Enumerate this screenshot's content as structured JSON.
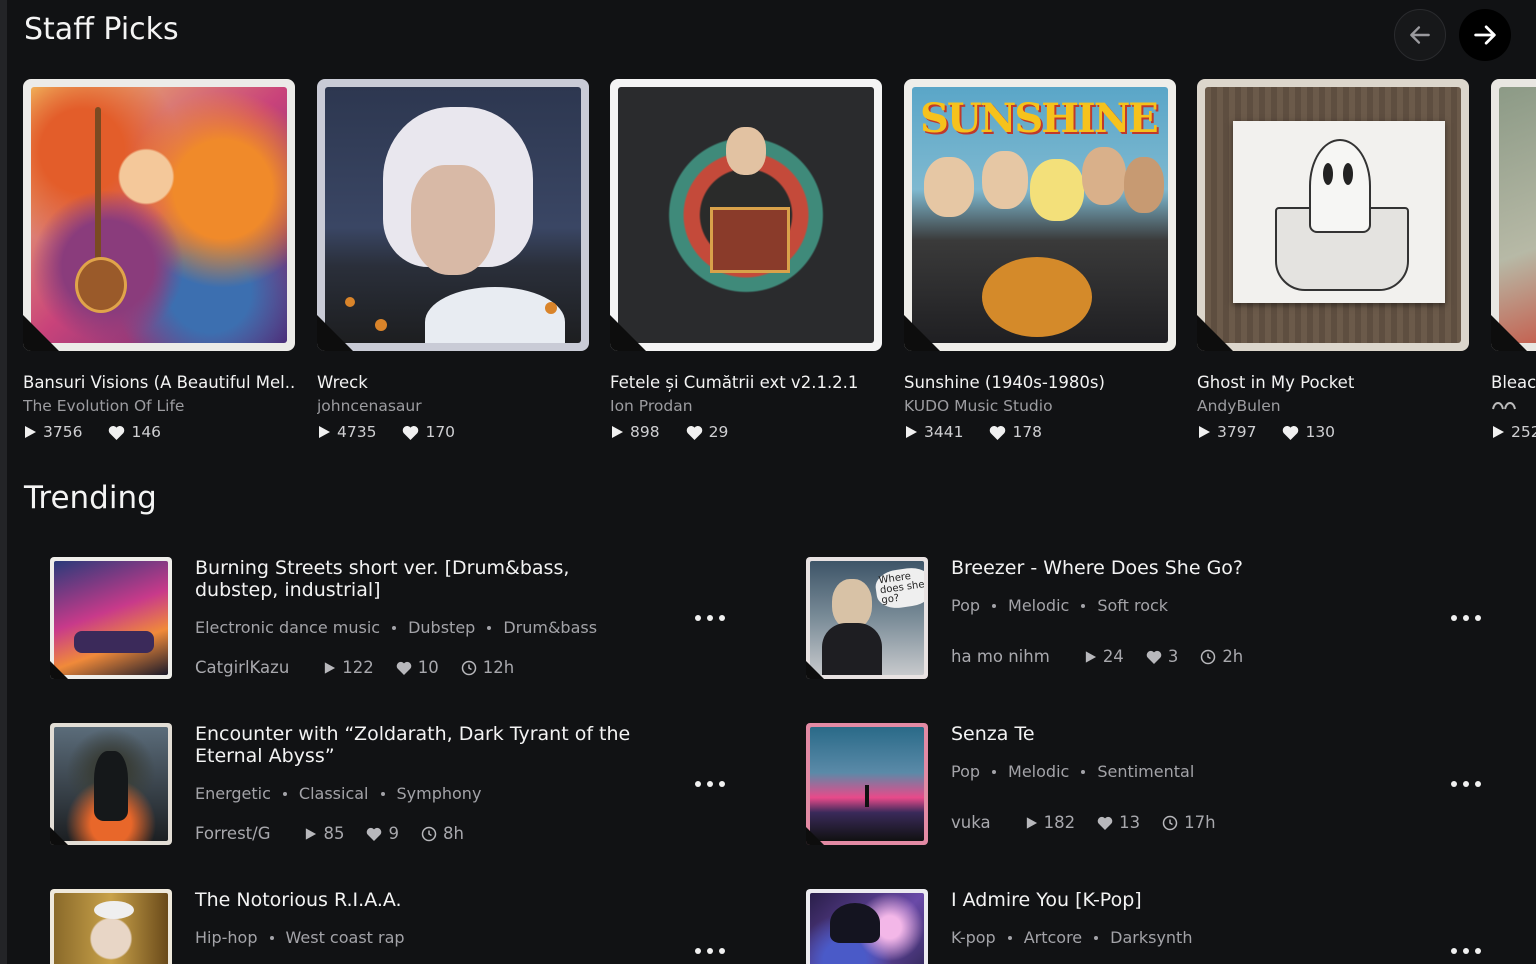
{
  "staff_picks": {
    "title": "Staff Picks",
    "prev_icon": "arrow-left-icon",
    "next_icon": "arrow-right-icon",
    "cards": [
      {
        "title": "Bansuri Visions (A Beautiful Mel...",
        "artist": "The Evolution Of Life",
        "plays": "3756",
        "likes": "146"
      },
      {
        "title": "Wreck",
        "artist": "johncenasaur",
        "plays": "4735",
        "likes": "170"
      },
      {
        "title": "Fetele și Cumătrii ext v2.1.2.1",
        "artist": "Ion Prodan",
        "plays": "898",
        "likes": "29"
      },
      {
        "title": "Sunshine (1940s-1980s)",
        "artist": "KUDO Music Studio",
        "plays": "3441",
        "likes": "178"
      },
      {
        "title": "Ghost in My Pocket",
        "artist": "AndyBulen",
        "plays": "3797",
        "likes": "130"
      },
      {
        "title": "Bleac",
        "artist": "",
        "plays": "252",
        "likes": ""
      }
    ],
    "art_text": {
      "sunshine": "SUNSHINE"
    }
  },
  "trending": {
    "title": "Trending",
    "items": [
      {
        "title": "Burning Streets short ver. [Drum&bass, dubstep, industrial]",
        "tags": [
          "Electronic dance music",
          "Dubstep",
          "Drum&bass"
        ],
        "artist": "CatgirlKazu",
        "plays": "122",
        "likes": "10",
        "age": "12h"
      },
      {
        "title": "Breezer - Where Does She Go?",
        "tags": [
          "Pop",
          "Melodic",
          "Soft rock"
        ],
        "artist": "ha mo nihm",
        "plays": "24",
        "likes": "3",
        "age": "2h"
      },
      {
        "title": "Encounter with “Zoldarath, Dark Tyrant of the Eternal Abyss”",
        "tags": [
          "Energetic",
          "Classical",
          "Symphony"
        ],
        "artist": "Forrest/G",
        "plays": "85",
        "likes": "9",
        "age": "8h"
      },
      {
        "title": "Senza Te",
        "tags": [
          "Pop",
          "Melodic",
          "Sentimental"
        ],
        "artist": "vuka",
        "plays": "182",
        "likes": "13",
        "age": "17h"
      },
      {
        "title": "The Notorious R.I.A.A.",
        "tags": [
          "Hip-hop",
          "West coast rap"
        ],
        "artist": "",
        "plays": "",
        "likes": "",
        "age": ""
      },
      {
        "title": "I Admire You [K-Pop]",
        "tags": [
          "K-pop",
          "Artcore",
          "Darksynth"
        ],
        "artist": "",
        "plays": "",
        "likes": "",
        "age": ""
      }
    ],
    "art_text": {
      "breezer": "Where does she go?"
    }
  },
  "colors": {
    "background": "#111214",
    "text": "#f2f2f2",
    "muted": "#a3a3a8"
  }
}
